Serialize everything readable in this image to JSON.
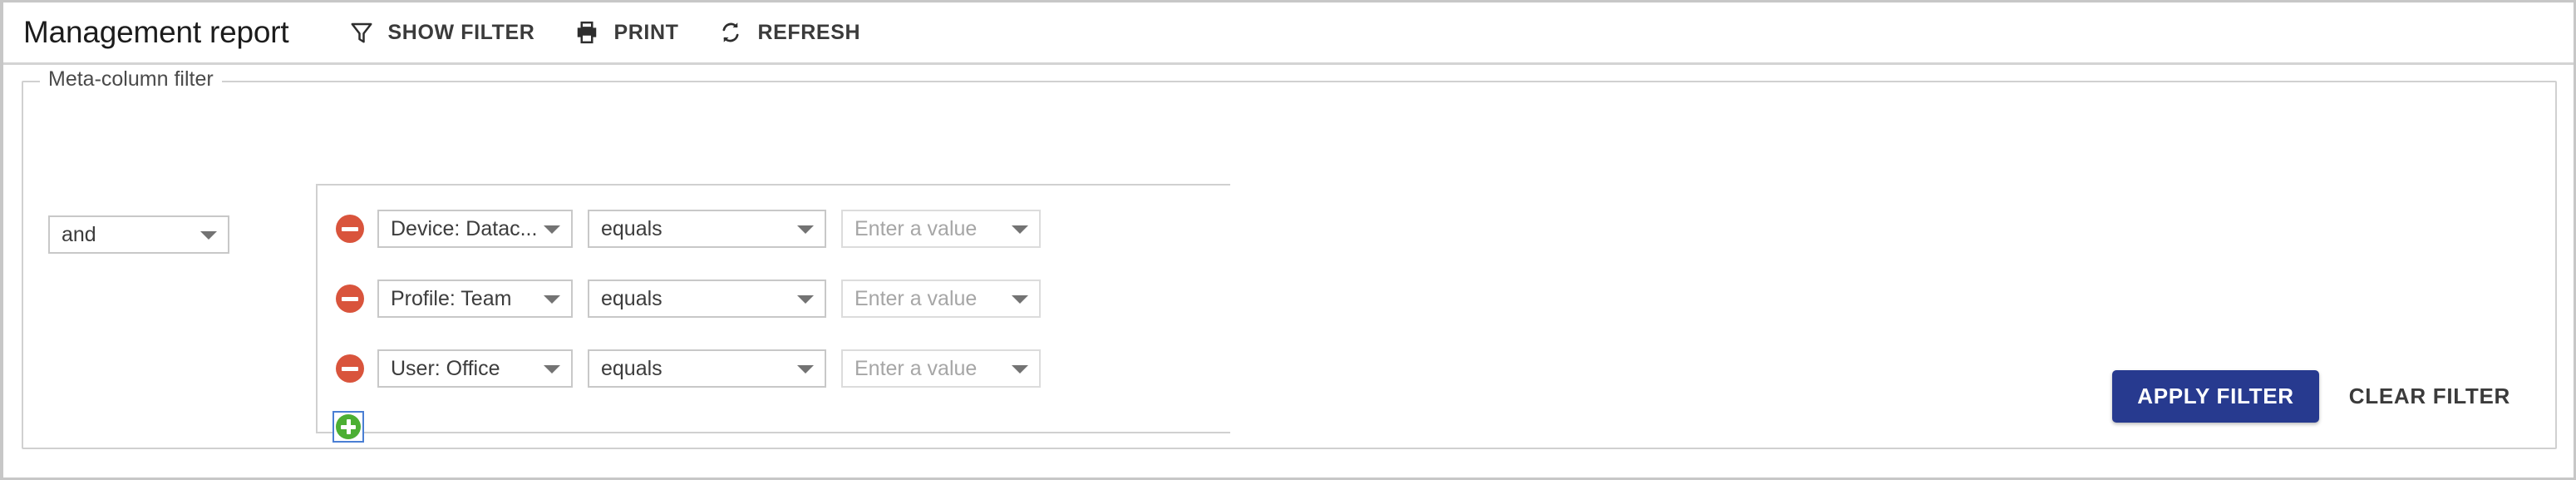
{
  "header": {
    "title": "Management report",
    "toolbar": [
      {
        "id": "show-filter",
        "label": "SHOW FILTER",
        "icon": "filter-icon"
      },
      {
        "id": "print",
        "label": "PRINT",
        "icon": "printer-icon"
      },
      {
        "id": "refresh",
        "label": "REFRESH",
        "icon": "refresh-icon"
      }
    ]
  },
  "filter_panel": {
    "legend": "Meta-column filter",
    "conjunction": {
      "value": "and"
    },
    "rows": [
      {
        "field": "Device: Datac...",
        "operator": "equals",
        "value": "",
        "value_placeholder": "Enter a value"
      },
      {
        "field": "Profile: Team",
        "operator": "equals",
        "value": "",
        "value_placeholder": "Enter a value"
      },
      {
        "field": "User: Office",
        "operator": "equals",
        "value": "",
        "value_placeholder": "Enter a value"
      }
    ],
    "add_row_label": "+",
    "remove_row_label": "-"
  },
  "actions": {
    "apply_label": "APPLY FILTER",
    "clear_label": "CLEAR FILTER"
  },
  "colors": {
    "primary": "#273a8f",
    "remove": "#d9543c",
    "add": "#4caf33",
    "focus_ring": "#4a7fd4",
    "border": "#d0d0d0"
  }
}
